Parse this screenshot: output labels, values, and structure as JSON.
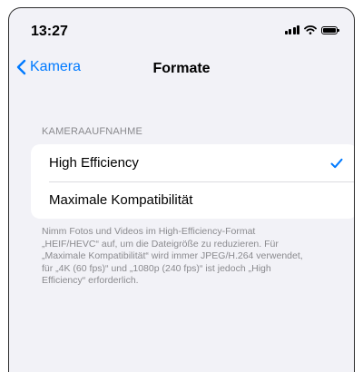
{
  "status_bar": {
    "time": "13:27",
    "icons": [
      "cellular-signal-icon",
      "wifi-icon",
      "battery-icon"
    ]
  },
  "nav": {
    "back_label": "Kamera",
    "title": "Formate"
  },
  "section": {
    "header": "KAMERAAUFNAHME",
    "options": [
      {
        "label": "High Efficiency",
        "selected": true
      },
      {
        "label": "Maximale Kompatibilität",
        "selected": false
      }
    ],
    "footer": "Nimm Fotos und Videos im High-Efficiency-Format „HEIF/HEVC“ auf, um die Dateigröße zu reduzieren. Für „Maximale Kompatibilität“ wird immer JPEG/H.264 verwendet, für „4K (60 fps)“ und „1080p (240 fps)“ ist jedoch „High Efficiency“ erforderlich."
  },
  "colors": {
    "accent": "#007aff",
    "background": "#f2f2f7",
    "cell": "#ffffff",
    "secondary_text": "#8a8a8e"
  }
}
